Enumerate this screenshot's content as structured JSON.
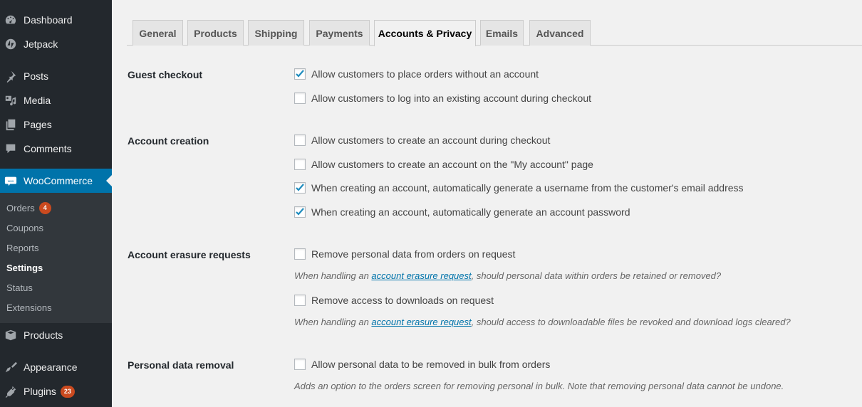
{
  "sidebar": {
    "items": [
      {
        "label": "Dashboard",
        "icon": "dashboard-icon"
      },
      {
        "label": "Jetpack",
        "icon": "jetpack-icon"
      },
      {
        "label": "Posts",
        "icon": "pin-icon"
      },
      {
        "label": "Media",
        "icon": "media-icon"
      },
      {
        "label": "Pages",
        "icon": "pages-icon"
      },
      {
        "label": "Comments",
        "icon": "comment-icon"
      },
      {
        "label": "WooCommerce",
        "icon": "woo-icon"
      },
      {
        "label": "Products",
        "icon": "box-icon"
      },
      {
        "label": "Appearance",
        "icon": "brush-icon"
      },
      {
        "label": "Plugins",
        "icon": "plugin-icon",
        "badge": "23"
      }
    ],
    "submenu": [
      {
        "label": "Orders",
        "badge": "4"
      },
      {
        "label": "Coupons"
      },
      {
        "label": "Reports"
      },
      {
        "label": "Settings",
        "current": true
      },
      {
        "label": "Status"
      },
      {
        "label": "Extensions"
      }
    ]
  },
  "tabs": [
    {
      "label": "General"
    },
    {
      "label": "Products"
    },
    {
      "label": "Shipping"
    },
    {
      "label": "Payments"
    },
    {
      "label": "Accounts & Privacy",
      "active": true
    },
    {
      "label": "Emails"
    },
    {
      "label": "Advanced"
    }
  ],
  "sections": {
    "guest_checkout": {
      "label": "Guest checkout",
      "options": [
        {
          "label": "Allow customers to place orders without an account",
          "checked": true
        },
        {
          "label": "Allow customers to log into an existing account during checkout",
          "checked": false
        }
      ]
    },
    "account_creation": {
      "label": "Account creation",
      "options": [
        {
          "label": "Allow customers to create an account during checkout",
          "checked": false
        },
        {
          "label": "Allow customers to create an account on the \"My account\" page",
          "checked": false
        },
        {
          "label": "When creating an account, automatically generate a username from the customer's email address",
          "checked": true
        },
        {
          "label": "When creating an account, automatically generate an account password",
          "checked": true
        }
      ]
    },
    "erasure": {
      "label": "Account erasure requests",
      "options": [
        {
          "label": "Remove personal data from orders on request",
          "checked": false,
          "desc_pre": "When handling an ",
          "desc_link": "account erasure request",
          "desc_post": ", should personal data within orders be retained or removed?"
        },
        {
          "label": "Remove access to downloads on request",
          "checked": false,
          "desc_pre": "When handling an ",
          "desc_link": "account erasure request",
          "desc_post": ", should access to downloadable files be revoked and download logs cleared?"
        }
      ]
    },
    "removal": {
      "label": "Personal data removal",
      "options": [
        {
          "label": "Allow personal data to be removed in bulk from orders",
          "checked": false,
          "desc": "Adds an option to the orders screen for removing personal in bulk. Note that removing personal data cannot be undone."
        }
      ]
    }
  },
  "colors": {
    "accent": "#0073aa",
    "badge": "#ca4a1f",
    "sidebar": "#23282d",
    "check": "#1e8cbe"
  }
}
